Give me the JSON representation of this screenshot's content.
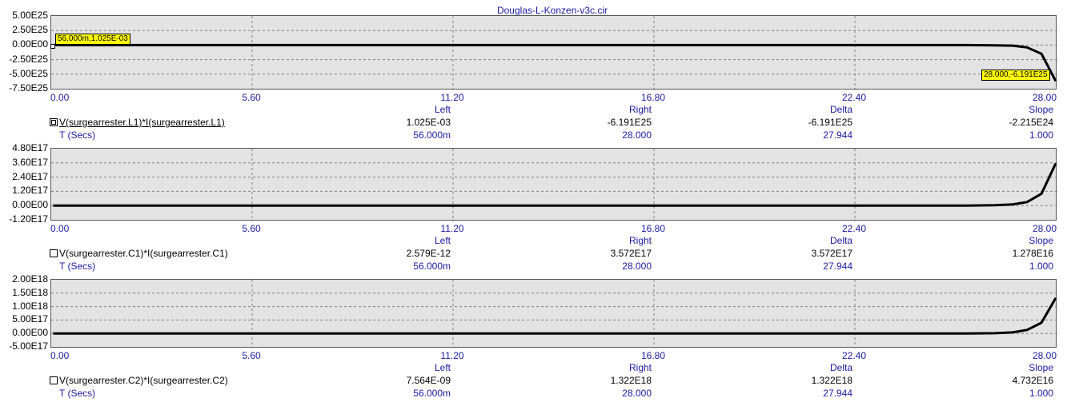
{
  "title": "Douglas-L-Konzen-v3c.cir",
  "x_ticks": [
    "0.00",
    "5.60",
    "11.20",
    "16.80",
    "22.40",
    "28.00"
  ],
  "stat_headers": [
    "Left",
    "Right",
    "Delta",
    "Slope"
  ],
  "time_label": "T (Secs)",
  "time_values": [
    "56.000m",
    "28.000",
    "27.944",
    "1.000"
  ],
  "colors": {
    "title": "#1a1aa0",
    "plot_bg": "#e3e3e3",
    "trace": "#000000",
    "marker_bg": "#ffff00"
  },
  "panels": [
    {
      "curve_label": "V(surgearrester.L1)*I(surgearrester.L1)",
      "checked": true,
      "y_ticks": [
        "5.00E25",
        "2.50E25",
        "0.00E00",
        "-2.50E25",
        "-5.00E25",
        "-7.50E25"
      ],
      "values": [
        "1.025E-03",
        "-6.191E25",
        "-6.191E25",
        "-2.215E24"
      ],
      "marker_left": "56.000m,1.025E-03",
      "marker_right": "28.000,-6.191E25"
    },
    {
      "curve_label": "V(surgearrester.C1)*I(surgearrester.C1)",
      "checked": false,
      "y_ticks": [
        "4.80E17",
        "3.60E17",
        "2.40E17",
        "1.20E17",
        "0.00E00",
        "-1.20E17"
      ],
      "values": [
        "2.579E-12",
        "3.572E17",
        "3.572E17",
        "1.278E16"
      ]
    },
    {
      "curve_label": "V(surgearrester.C2)*I(surgearrester.C2)",
      "checked": false,
      "y_ticks": [
        "2.00E18",
        "1.50E18",
        "1.00E18",
        "5.00E17",
        "0.00E00",
        "-5.00E17"
      ],
      "values": [
        "7.564E-09",
        "1.322E18",
        "1.322E18",
        "4.732E16"
      ]
    }
  ],
  "chart_data": [
    {
      "type": "line",
      "title": "Douglas-L-Konzen-v3c.cir",
      "xlabel": "T (Secs)",
      "ylabel": "V(surgearrester.L1)*I(surgearrester.L1)",
      "xlim": [
        0,
        28
      ],
      "ylim": [
        -7.5e+25,
        5e+25
      ],
      "grid": true,
      "series": [
        {
          "name": "V(surgearrester.L1)*I(surgearrester.L1)",
          "x": [
            0.056,
            22.4,
            25.5,
            26.3,
            26.8,
            27.2,
            27.6,
            28.0
          ],
          "y": [
            0.001025,
            0,
            -1e+22,
            -4e+23,
            -1e+24,
            -4e+24,
            -1.5e+25,
            -6.191e+25
          ]
        }
      ]
    },
    {
      "type": "line",
      "xlabel": "T (Secs)",
      "ylabel": "V(surgearrester.C1)*I(surgearrester.C1)",
      "xlim": [
        0,
        28
      ],
      "ylim": [
        -1.2e+17,
        4.8e+17
      ],
      "grid": true,
      "series": [
        {
          "name": "V(surgearrester.C1)*I(surgearrester.C1)",
          "x": [
            0.056,
            22.4,
            25.5,
            26.3,
            26.8,
            27.2,
            27.6,
            28.0
          ],
          "y": [
            2.579e-12,
            0,
            100000000000000.0,
            3000000000000000.0,
            1e+16,
            3e+16,
            1e+17,
            3.572e+17
          ]
        }
      ]
    },
    {
      "type": "line",
      "xlabel": "T (Secs)",
      "ylabel": "V(surgearrester.C2)*I(surgearrester.C2)",
      "xlim": [
        0,
        28
      ],
      "ylim": [
        -5e+17,
        2e+18
      ],
      "grid": true,
      "series": [
        {
          "name": "V(surgearrester.C2)*I(surgearrester.C2)",
          "x": [
            0.056,
            22.4,
            25.5,
            26.3,
            26.8,
            27.2,
            27.6,
            28.0
          ],
          "y": [
            7.564e-09,
            0,
            500000000000000.0,
            1e+16,
            4e+16,
            1.3e+17,
            4e+17,
            1.322e+18
          ]
        }
      ]
    }
  ]
}
